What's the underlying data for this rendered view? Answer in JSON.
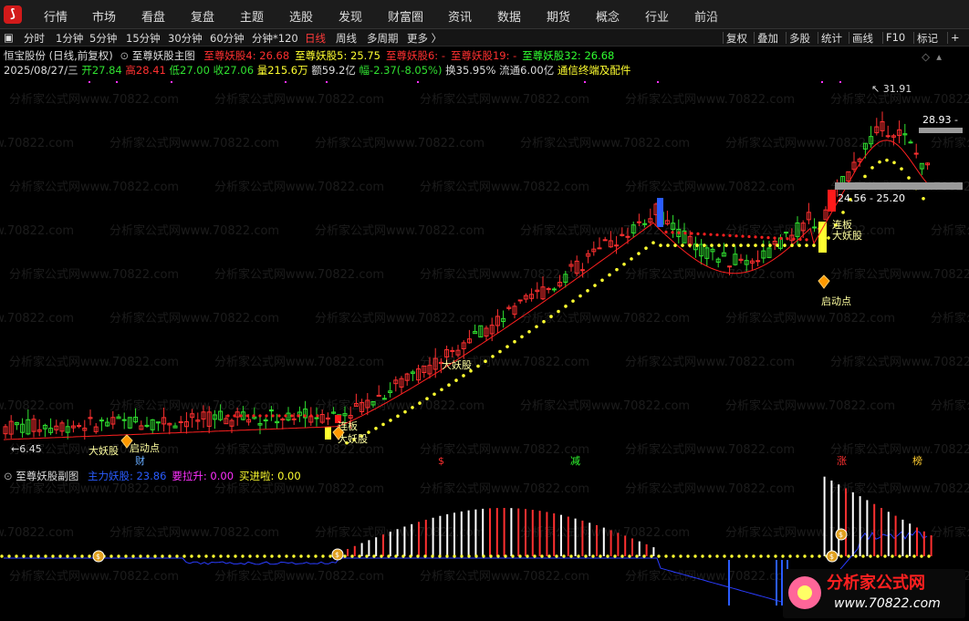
{
  "menu": [
    "行情",
    "市场",
    "看盘",
    "复盘",
    "主题",
    "选股",
    "发现",
    "财富圈",
    "资讯",
    "数据",
    "期货",
    "概念",
    "行业",
    "前沿"
  ],
  "periods": [
    "分时",
    "1分钟",
    "5分钟",
    "15分钟",
    "30分钟",
    "60分钟",
    "分钟*120",
    "日线",
    "周线",
    "多周期",
    "更多 〉"
  ],
  "active_period": "日线",
  "tools": [
    "复权",
    "叠加",
    "多股",
    "统计",
    "画线",
    "F10",
    "标记",
    "+"
  ],
  "stock": {
    "name_line": "恒宝股份 (日线,前复权)",
    "indicator_name": "至尊妖股主图",
    "ind_values": [
      {
        "label": "至尊妖股4: 26.68",
        "color": "#ff3030"
      },
      {
        "label": "至尊妖股5: 25.75",
        "color": "#ffff30"
      },
      {
        "label": "至尊妖股6: -",
        "color": "#ff3030"
      },
      {
        "label": "至尊妖股19: -",
        "color": "#ff3030"
      },
      {
        "label": "至尊妖股32: 26.68",
        "color": "#30ff30"
      }
    ],
    "date": "2025/08/27/三",
    "open": "开27.84",
    "high": "高28.41",
    "low": "低27.00",
    "close": "收27.06",
    "volume": "量215.6万",
    "amount": "额59.2亿",
    "change": "幅-2.37(-8.05%)",
    "turnover": "换35.95%",
    "float": "流通6.00亿",
    "concept": "通信终端及配件"
  },
  "price_labels": {
    "high_mark": "31.91",
    "current": "28.93",
    "range": "24.56 - 25.20",
    "low_mark": "←6.45"
  },
  "annotations": [
    "大妖股",
    "启动点",
    "连板",
    "大妖股",
    "大妖股",
    "连板",
    "大妖股",
    "启动点",
    "财",
    "$",
    "减",
    "涨",
    "榜"
  ],
  "sub": {
    "name": "至尊妖股副图",
    "values": [
      {
        "label": "主力妖股: 23.86",
        "color": "#2a5cff"
      },
      {
        "label": "要拉升: 0.00",
        "color": "#ff30ff"
      },
      {
        "label": "买进啦: 0.00",
        "color": "#ffff30"
      }
    ]
  },
  "watermark": "分析家公式网www.70822.com",
  "brand": {
    "name": "分析家公式网",
    "url": "www.70822.com"
  },
  "colors": {
    "up": "#ff3030",
    "down": "#30e030",
    "ma": "#ffff30",
    "bg": "#000000",
    "blue": "#2a5cff"
  }
}
